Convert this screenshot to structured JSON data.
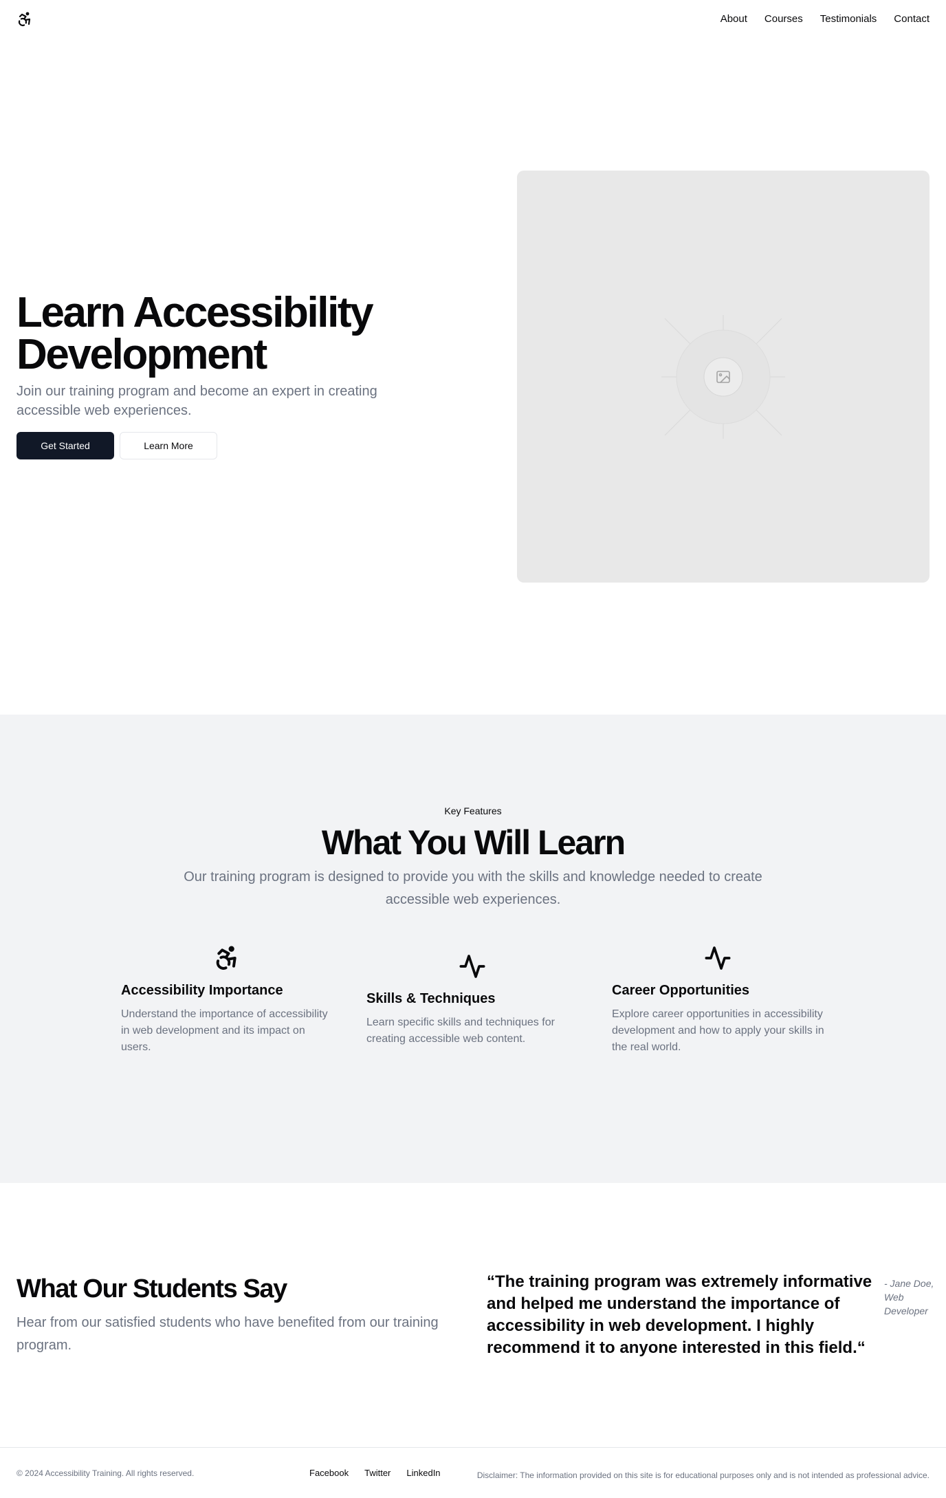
{
  "header": {
    "logo_icon": "accessibility-icon",
    "nav": [
      "About",
      "Courses",
      "Testimonials",
      "Contact"
    ]
  },
  "hero": {
    "title": "Learn Accessibility Development",
    "subtitle": "Join our training program and become an expert in creating accessible web experiences.",
    "primary_button": "Get Started",
    "secondary_button": "Learn More",
    "image_icon": "image-placeholder-icon"
  },
  "features": {
    "eyebrow": "Key Features",
    "title": "What You Will Learn",
    "subtitle": "Our training program is designed to provide you with the skills and knowledge needed to create accessible web experiences.",
    "items": [
      {
        "icon": "accessibility-icon",
        "title": "Accessibility Importance",
        "text": "Understand the importance of accessibility in web development and its impact on users."
      },
      {
        "icon": "activity-icon",
        "title": "Skills & Techniques",
        "text": "Learn specific skills and techniques for creating accessible web content."
      },
      {
        "icon": "activity-icon",
        "title": "Career Opportunities",
        "text": "Explore career opportunities in accessibility development and how to apply your skills in the real world."
      }
    ]
  },
  "testimonials": {
    "title": "What Our Students Say",
    "subtitle": "Hear from our satisfied students who have benefited from our training program.",
    "quote": "“The training program was extremely informative and helped me understand the importance of accessibility in web development. I highly recommend it to anyone interested in this field.“",
    "author": "- Jane Doe, Web Developer"
  },
  "footer": {
    "copyright": "© 2024 Accessibility Training. All rights reserved.",
    "links": [
      "Facebook",
      "Twitter",
      "LinkedIn"
    ],
    "disclaimer": "Disclaimer: The information provided on this site is for educational purposes only and is not intended as professional advice."
  },
  "colors": {
    "primary": "#111827",
    "muted_text": "#6b7280",
    "section_bg": "#f2f3f5",
    "placeholder_bg": "#e8e8e8"
  }
}
